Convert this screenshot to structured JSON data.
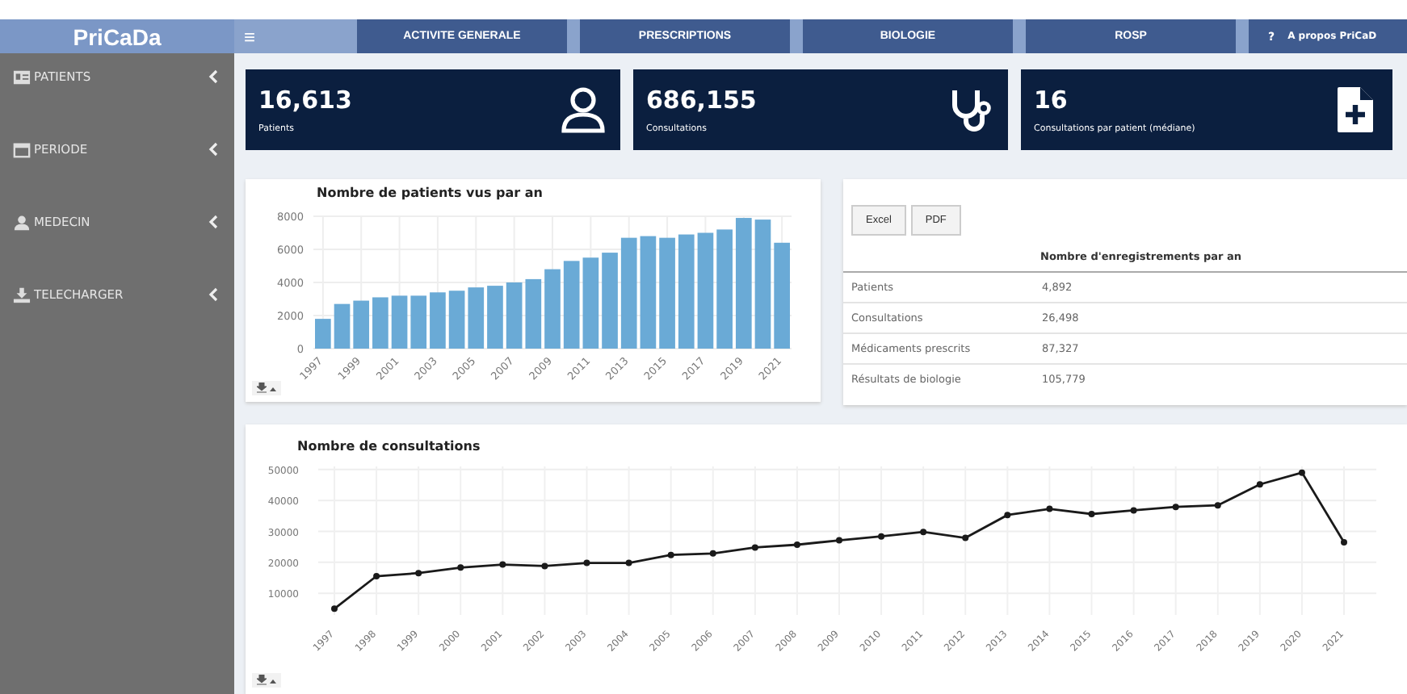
{
  "header": {
    "logo": "PriCaDa",
    "menu_icon": "≡",
    "tabs": [
      {
        "label": "ACTIVITE GENERALE",
        "selected": false
      },
      {
        "label": "PRESCRIPTIONS",
        "selected": false
      },
      {
        "label": "BIOLOGIE",
        "selected": false
      },
      {
        "label": "ROSP",
        "selected": false
      }
    ],
    "help": "?",
    "about": "A propos PriCaD"
  },
  "sidebar": {
    "items": [
      {
        "label": "PATIENTS",
        "kind": "id-card"
      },
      {
        "label": "PERIODE",
        "kind": "calendar"
      },
      {
        "label": "MEDECIN",
        "kind": "user"
      },
      {
        "label": "TELECHARGER",
        "kind": "download"
      }
    ]
  },
  "stats": [
    {
      "value": "16,613",
      "label": "Patients",
      "kind": "person"
    },
    {
      "value": "686,155",
      "label": "Consultations",
      "kind": "stethoscope"
    },
    {
      "value": "16",
      "label": "Consultations par patient (médiane)",
      "kind": "file-plus"
    }
  ],
  "bar_panel": {
    "chart_data": {
      "type": "bar",
      "title": "Nombre de patients vus par an",
      "x": [
        1997,
        1998,
        1999,
        2000,
        2001,
        2002,
        2003,
        2004,
        2005,
        2006,
        2007,
        2008,
        2009,
        2010,
        2011,
        2012,
        2013,
        2014,
        2015,
        2016,
        2017,
        2018,
        2019,
        2020,
        2021
      ],
      "xticks": [
        1997,
        1999,
        2001,
        2003,
        2005,
        2007,
        2009,
        2011,
        2013,
        2015,
        2017,
        2019,
        2021
      ],
      "series": [
        {
          "color": "#6aaad6",
          "values": [
            1800,
            2700,
            2900,
            3100,
            3200,
            3200,
            3400,
            3500,
            3700,
            3800,
            4000,
            4200,
            4800,
            5300,
            5500,
            5800,
            6700,
            6800,
            6700,
            6900,
            7000,
            7200,
            7900,
            7800,
            6400
          ]
        }
      ],
      "xlim": [
        1996.5,
        2021.5
      ],
      "ylim": [
        0,
        8000
      ],
      "yticks": [
        0,
        2000,
        4000,
        6000,
        8000
      ],
      "grid": true
    }
  },
  "table_panel": {
    "buttons": [
      "Excel",
      "PDF"
    ],
    "columns": [
      "",
      "Nombre d'enregistrements par an"
    ],
    "rows": [
      [
        "Patients",
        "4,892"
      ],
      [
        "Consultations",
        "26,498"
      ],
      [
        "Médicaments prescrits",
        "87,327"
      ],
      [
        "Résultats de biologie",
        "105,779"
      ]
    ]
  },
  "line_panel": {
    "chart_data": {
      "type": "line",
      "title": "Nombre de consultations",
      "categories": [
        "1997",
        "1998",
        "1999",
        "2000",
        "2001",
        "2002",
        "2003",
        "2004",
        "2005",
        "2006",
        "2007",
        "2008",
        "2009",
        "2010",
        "2011",
        "2012",
        "2013",
        "2014",
        "2015",
        "2016",
        "2017",
        "2018",
        "2019",
        "2020",
        "2021"
      ],
      "series": [
        {
          "color": "#1a1a1a",
          "marker": "circle",
          "values": [
            5000,
            15500,
            16500,
            18300,
            19300,
            18800,
            19800,
            19800,
            22400,
            22900,
            24800,
            25700,
            27100,
            28400,
            29800,
            27900,
            35300,
            37300,
            35600,
            36800,
            37900,
            38400,
            45200,
            49000,
            26500
          ]
        }
      ],
      "ylim": [
        3000,
        51000
      ],
      "yticks": [
        10000,
        20000,
        30000,
        40000,
        50000
      ],
      "grid": true
    }
  }
}
